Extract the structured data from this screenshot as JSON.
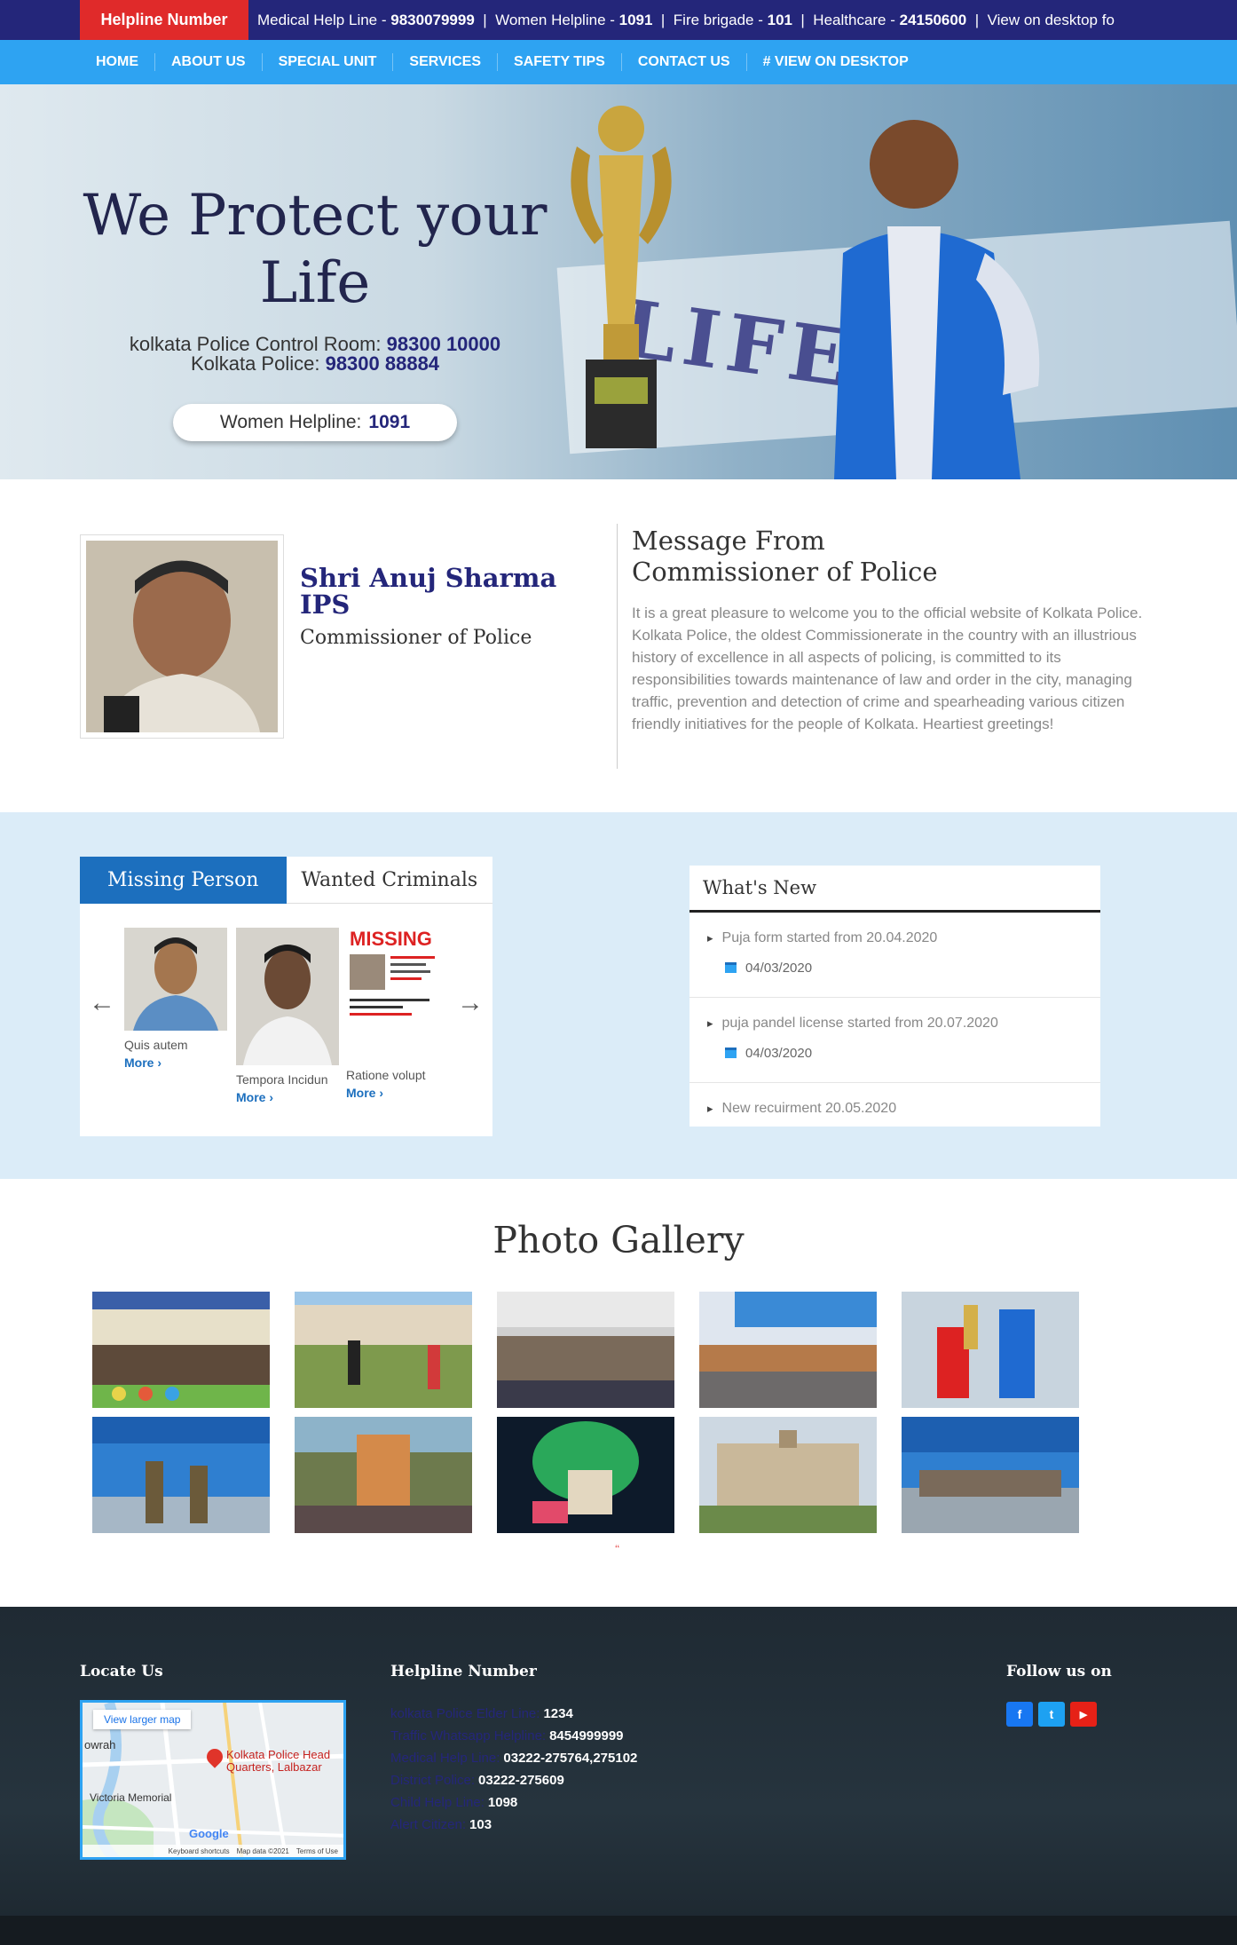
{
  "topbar": {
    "helpline_label": "Helpline Number",
    "ticker": [
      {
        "label": "Medical Help Line - ",
        "value": "9830079999"
      },
      {
        "label": "Women Helpline - ",
        "value": "1091"
      },
      {
        "label": "Fire brigade - ",
        "value": "101"
      },
      {
        "label": "Healthcare - ",
        "value": "24150600"
      },
      {
        "label": "View on desktop fo",
        "value": ""
      }
    ]
  },
  "nav": [
    "HOME",
    "ABOUT US",
    "SPECIAL UNIT",
    "SERVICES",
    "SAFETY TIPS",
    "CONTACT US",
    "# VIEW ON DESKTOP"
  ],
  "hero": {
    "title_line1": "We Protect your",
    "title_line2": "Life",
    "control_room_label": "kolkata Police Control Room: ",
    "control_room_number": "98300 10000",
    "police_label": "Kolkata Police: ",
    "police_number": "98300 88884",
    "women_label": "Women Helpline:",
    "women_number": "1091",
    "banner_text": "LIFE"
  },
  "commissioner": {
    "name": "Shri Anuj Sharma IPS",
    "role": "Commissioner of Police",
    "message_title_line1": "Message From",
    "message_title_line2": "Commissioner of Police",
    "message_body": "It is a great pleasure to welcome you to the official website of Kolkata Police. Kolkata Police, the oldest Commissionerate in the country with an illustrious history of excellence in all aspects of policing, is committed to its responsibilities towards maintenance of law and order in the city, managing traffic, prevention and detection of crime and spearheading various citizen friendly initiatives for the people of Kolkata. Heartiest greetings!"
  },
  "missing": {
    "tabs": [
      "Missing Person",
      "Wanted Criminals"
    ],
    "cards": [
      {
        "caption": "Quis autem",
        "more": "More ›"
      },
      {
        "caption": "Tempora Incidun",
        "more": "More ›"
      },
      {
        "caption": "Ratione volupt",
        "more": "More ›"
      }
    ],
    "poster_text": "MISSING"
  },
  "whats_new": {
    "title": "What's New",
    "items": [
      {
        "text": "Puja form started from 20.04.2020",
        "date": "04/03/2020"
      },
      {
        "text": "puja pandel license started from 20.07.2020",
        "date": "04/03/2020"
      },
      {
        "text": "New recuirment 20.05.2020",
        "date": ""
      }
    ]
  },
  "gallery": {
    "title": "Photo Gallery",
    "dots": "‘‘"
  },
  "footer": {
    "locate_title": "Locate Us",
    "helpline_title": "Helpline Number",
    "follow_title": "Follow us on",
    "map": {
      "button": "View larger map",
      "place": "Kolkata Police Head Quarters, Lalbazar",
      "howrah": "owrah",
      "victoria": "Victoria Memorial",
      "google": "Google",
      "foot_shortcuts": "Keyboard shortcuts",
      "foot_data": "Map data ©2021",
      "foot_terms": "Terms of Use"
    },
    "helplines": [
      {
        "label": "kolkata Police Elder Line:",
        "value": "1234"
      },
      {
        "label": "Traffic Whatsapp Helpline:",
        "value": "8454999999"
      },
      {
        "label": "Medical Help Line:",
        "value": "03222-275764,275102"
      },
      {
        "label": "District Police:",
        "value": "03222-275609"
      },
      {
        "label": "Child Help Line:",
        "value": "1098"
      },
      {
        "label": "Alert Citizen:",
        "value": "103"
      }
    ],
    "social": [
      {
        "icon": "facebook-icon",
        "glyph": "f",
        "color": "#1877f2"
      },
      {
        "icon": "twitter-icon",
        "glyph": "t",
        "color": "#1da1f2"
      },
      {
        "icon": "youtube-icon",
        "glyph": "▶",
        "color": "#e62117"
      }
    ]
  }
}
